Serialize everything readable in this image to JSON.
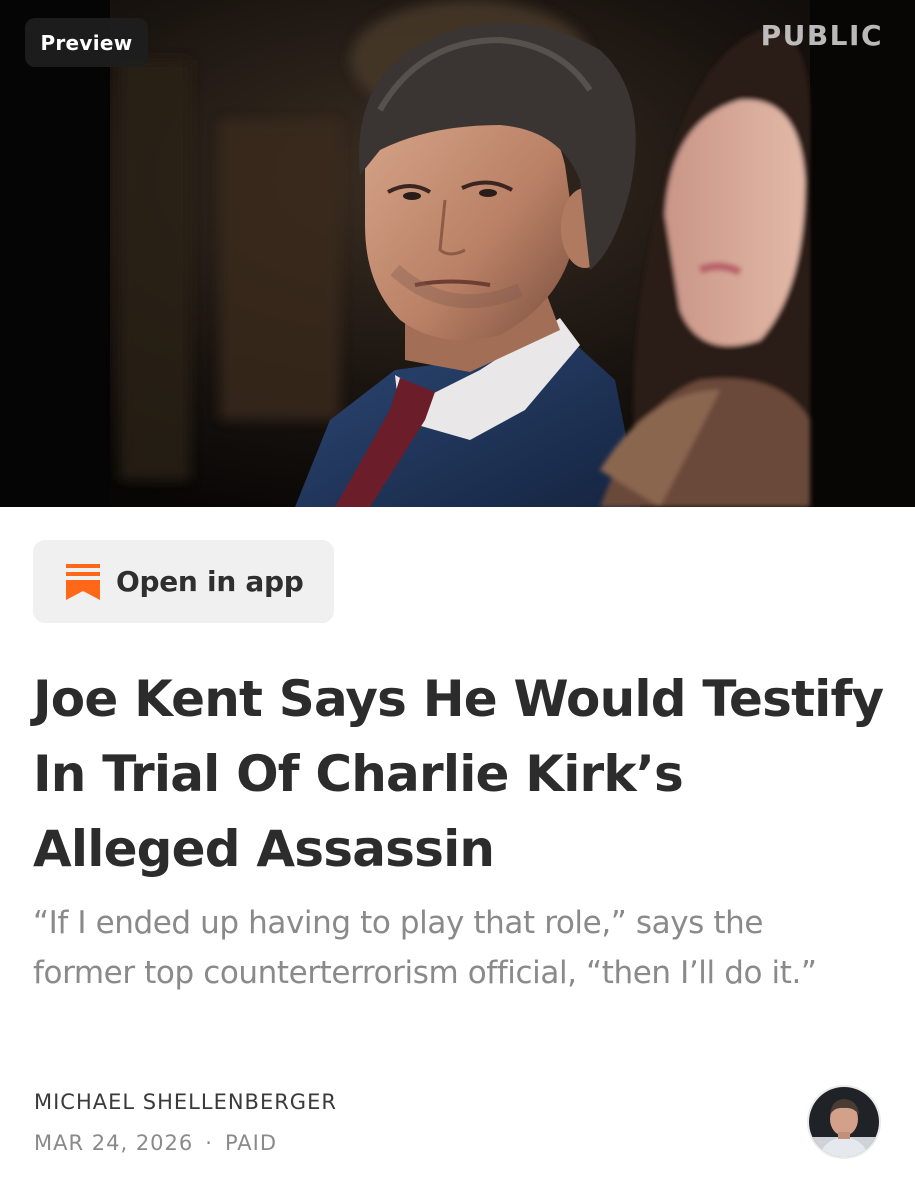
{
  "hero": {
    "badge": "Preview",
    "publication": "PUBLIC"
  },
  "open_in_app": {
    "label": "Open in app",
    "icon": "substack-bookmark-icon",
    "icon_color": "#ff6719"
  },
  "article": {
    "title": "Joe Kent Says He Would Testify In Trial Of Charlie Kirk’s Alleged Assassin",
    "subtitle": "“If I ended up having to play that role,” says the former top counterterrorism official, “then I’ll do it.”",
    "author": "MICHAEL SHELLENBERGER",
    "date": "MAR 24, 2026",
    "separator": "·",
    "access": "PAID"
  }
}
